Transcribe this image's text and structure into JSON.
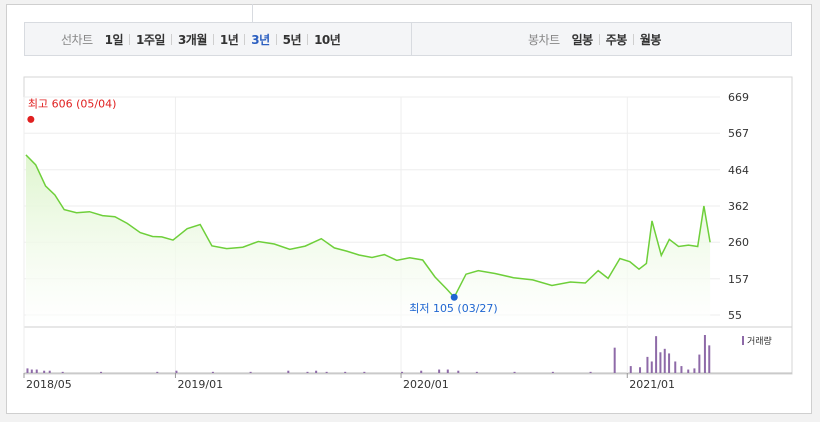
{
  "toolbar": {
    "period_label": "선차트",
    "period_items": [
      "1일",
      "1주일",
      "3개월",
      "1년",
      "3년",
      "5년",
      "10년"
    ],
    "active_period": 4,
    "candle_label": "봉차트",
    "candle_items": [
      "일봉",
      "주봉",
      "월봉"
    ]
  },
  "chart_data": {
    "type": "area",
    "yticks": [
      669,
      567,
      464,
      362,
      260,
      157,
      55
    ],
    "ylim": [
      55,
      669
    ],
    "x_tick_labels": [
      "2018/05",
      "2019/01",
      "2020/01",
      "2021/01"
    ],
    "x_tick_dates": [
      "2018-05-01",
      "2019-01-01",
      "2020-01-01",
      "2021-01-01"
    ],
    "x_range": [
      "2018-05-01",
      "2021-05-31"
    ],
    "series": [
      {
        "x": [
          "2018-05-04",
          "2018-05-20",
          "2018-06-05",
          "2018-06-20",
          "2018-07-05",
          "2018-07-25",
          "2018-08-15",
          "2018-09-05",
          "2018-09-25",
          "2018-10-15",
          "2018-11-05",
          "2018-11-25",
          "2018-12-10",
          "2018-12-28",
          "2019-01-20",
          "2019-02-10",
          "2019-03-01",
          "2019-03-25",
          "2019-04-20",
          "2019-05-15",
          "2019-06-10",
          "2019-07-05",
          "2019-07-30",
          "2019-08-25",
          "2019-09-15",
          "2019-10-05",
          "2019-10-25",
          "2019-11-15",
          "2019-12-05",
          "2019-12-25",
          "2020-01-15",
          "2020-02-05",
          "2020-02-25",
          "2020-03-15",
          "2020-03-27",
          "2020-04-15",
          "2020-05-05",
          "2020-06-01",
          "2020-07-01",
          "2020-08-01",
          "2020-09-01",
          "2020-10-01",
          "2020-10-25",
          "2020-11-15",
          "2020-12-01",
          "2020-12-20",
          "2021-01-05",
          "2021-01-20",
          "2021-02-01",
          "2021-02-10",
          "2021-02-25",
          "2021-03-10",
          "2021-03-25",
          "2021-04-10",
          "2021-04-25",
          "2021-05-05",
          "2021-05-15"
        ],
        "values": [
          506,
          478,
          418,
          393,
          352,
          343,
          346,
          335,
          332,
          313,
          287,
          276,
          275,
          266,
          298,
          310,
          250,
          242,
          246,
          262,
          255,
          240,
          249,
          270,
          244,
          235,
          224,
          217,
          225,
          209,
          216,
          210,
          162,
          128,
          105,
          170,
          180,
          172,
          160,
          154,
          138,
          148,
          145,
          180,
          158,
          214,
          205,
          184,
          200,
          320,
          223,
          268,
          248,
          252,
          248,
          362,
          260
        ],
        "color": "#6ecf3a",
        "fill": "#dff5cf"
      }
    ],
    "annotations": {
      "high_label": "최고 606 (05/04)",
      "high_value": 606,
      "high_date": "2018-05-04",
      "low_label": "최저 105 (03/27)",
      "low_value": 105,
      "low_date": "2020-03-27"
    },
    "volume": {
      "label": "거래량",
      "color": "#8e6aa8",
      "dates": [
        "2018-05-05",
        "2018-05-12",
        "2018-05-20",
        "2018-06-01",
        "2018-06-10",
        "2018-07-01",
        "2018-09-01",
        "2018-12-01",
        "2019-01-01",
        "2019-03-01",
        "2019-05-01",
        "2019-07-01",
        "2019-08-01",
        "2019-08-15",
        "2019-09-01",
        "2019-10-01",
        "2019-11-01",
        "2020-01-01",
        "2020-02-01",
        "2020-03-01",
        "2020-03-15",
        "2020-04-01",
        "2020-05-01",
        "2020-07-01",
        "2020-09-01",
        "2020-11-01",
        "2020-12-10",
        "2021-01-05",
        "2021-01-20",
        "2021-02-01",
        "2021-02-08",
        "2021-02-15",
        "2021-02-22",
        "2021-03-01",
        "2021-03-08",
        "2021-03-18",
        "2021-03-28",
        "2021-04-08",
        "2021-04-18",
        "2021-04-26",
        "2021-05-05",
        "2021-05-12"
      ],
      "values": [
        4,
        3,
        3,
        2,
        2,
        1,
        1,
        1,
        2,
        1,
        1,
        2,
        1,
        2,
        1,
        1,
        1,
        1,
        2,
        3,
        3,
        2,
        1,
        1,
        1,
        1,
        22,
        6,
        5,
        14,
        10,
        32,
        18,
        21,
        17,
        10,
        6,
        3,
        4,
        16,
        33,
        24
      ]
    }
  }
}
